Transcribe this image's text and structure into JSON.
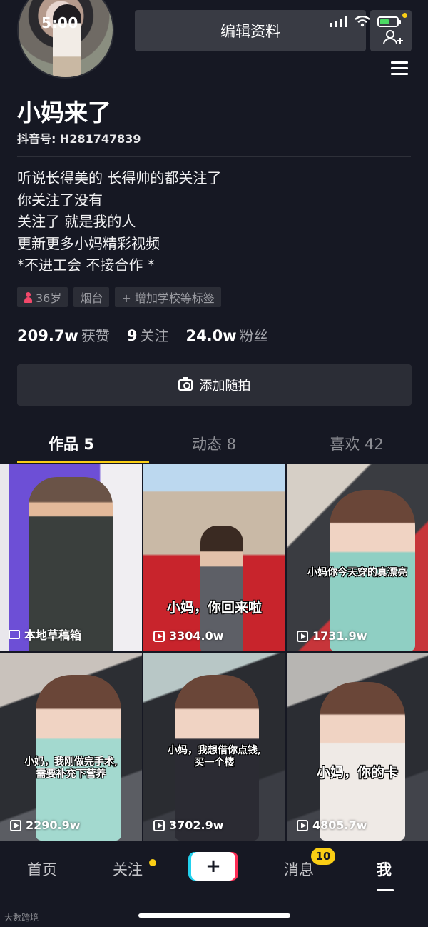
{
  "status_bar": {
    "time": "5:00"
  },
  "header": {
    "edit_profile_label": "编辑资料"
  },
  "profile": {
    "name": "小妈来了",
    "douyin_id": "抖音号: H281747839",
    "bio": [
      "听说长得美的 长得帅的都关注了",
      "你关注了没有",
      "关注了 就是我的人",
      "更新更多小妈精彩视频",
      "*不进工会 不接合作 *"
    ],
    "tags": {
      "age": "36岁",
      "city": "烟台",
      "add_school": "+ 增加学校等标签"
    },
    "stats": {
      "likes_num": "209.7w",
      "likes_label": "获赞",
      "following_num": "9",
      "following_label": "关注",
      "followers_num": "24.0w",
      "followers_label": "粉丝"
    },
    "add_moment_label": "添加随拍"
  },
  "tabs": [
    {
      "label": "作品 5",
      "active": true
    },
    {
      "label": "动态 8",
      "active": false
    },
    {
      "label": "喜欢 42",
      "active": false
    }
  ],
  "videos": [
    {
      "caption": "",
      "footer": "本地草稿箱",
      "is_draft": true
    },
    {
      "caption": "小妈，你回来啦",
      "footer": "3304.0w"
    },
    {
      "caption": "小妈你今天穿的真漂亮",
      "footer": "1731.9w"
    },
    {
      "caption_line1": "小妈，我刚做完手术,",
      "caption_line2": "需要补充下营养",
      "footer": "2290.9w"
    },
    {
      "caption_line1": "小妈，我想借你点钱,",
      "caption_line2": "买一个楼",
      "footer": "3702.9w"
    },
    {
      "caption": "小妈，你的卡",
      "footer": "4805.7w"
    }
  ],
  "bottom_nav": {
    "home": "首页",
    "following": "关注",
    "plus": "+",
    "messages": "消息",
    "messages_badge": "10",
    "me": "我"
  },
  "watermark": "大數跨境",
  "colors": {
    "background": "#161823",
    "accent": "#face15",
    "tiktok_red": "#fe2c55",
    "tiktok_cyan": "#22d1ee"
  }
}
